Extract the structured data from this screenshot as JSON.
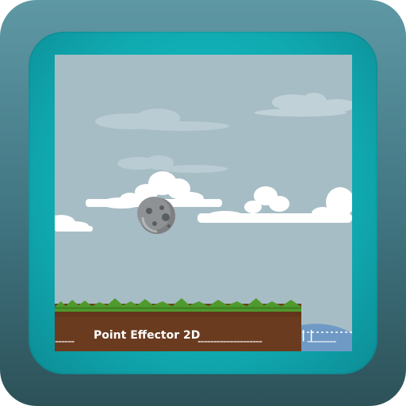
{
  "scene": {
    "title": "Point Effector 2D",
    "dash_left": "------",
    "dash_mid": "--------------------",
    "separator": "| |",
    "dash_right": "---------",
    "colors": {
      "outer_frame": "#4f8893",
      "inner_frame": "#11b8bf",
      "sky": "#a7bdc5",
      "grass": "#4f9a2d",
      "soil": "#6b3b1f",
      "water": "#6f9ac6",
      "text": "#ffffff"
    }
  },
  "elements": {
    "ball": "stone-ball",
    "platform": "grass-dirt-platform",
    "water": "water-hill",
    "clouds": [
      "cloud-left",
      "cloud-center",
      "cloud-right",
      "cloud-top-right",
      "cloud-faint"
    ]
  }
}
